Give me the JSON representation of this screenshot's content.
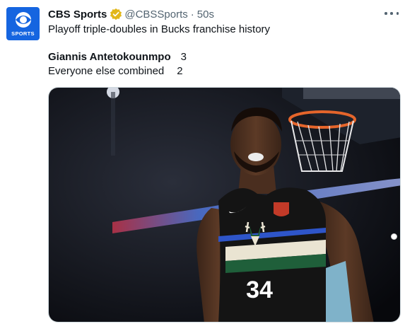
{
  "post": {
    "author_name": "CBS Sports",
    "handle": "@CBSSports",
    "separator": "·",
    "timestamp": "50s",
    "avatar_label": "SPORTS",
    "text_line1": "Playoff triple-doubles in Bucks franchise history",
    "stats": [
      {
        "label": "Giannis Antetokounmpo",
        "value": "3"
      },
      {
        "label": "Everyone else combined",
        "value": "2"
      }
    ],
    "media": {
      "jersey_number": "34"
    }
  },
  "colors": {
    "brand_blue": "#1565e0",
    "verified_gold": "#e2b719",
    "text_primary": "#0f1419",
    "text_secondary": "#536471",
    "jersey_black": "#141414",
    "jersey_green": "#1f5f3a"
  },
  "icons": {
    "avatar": "cbs-eye-icon",
    "verified": "verified-badge-icon",
    "more": "more-options-icon"
  }
}
